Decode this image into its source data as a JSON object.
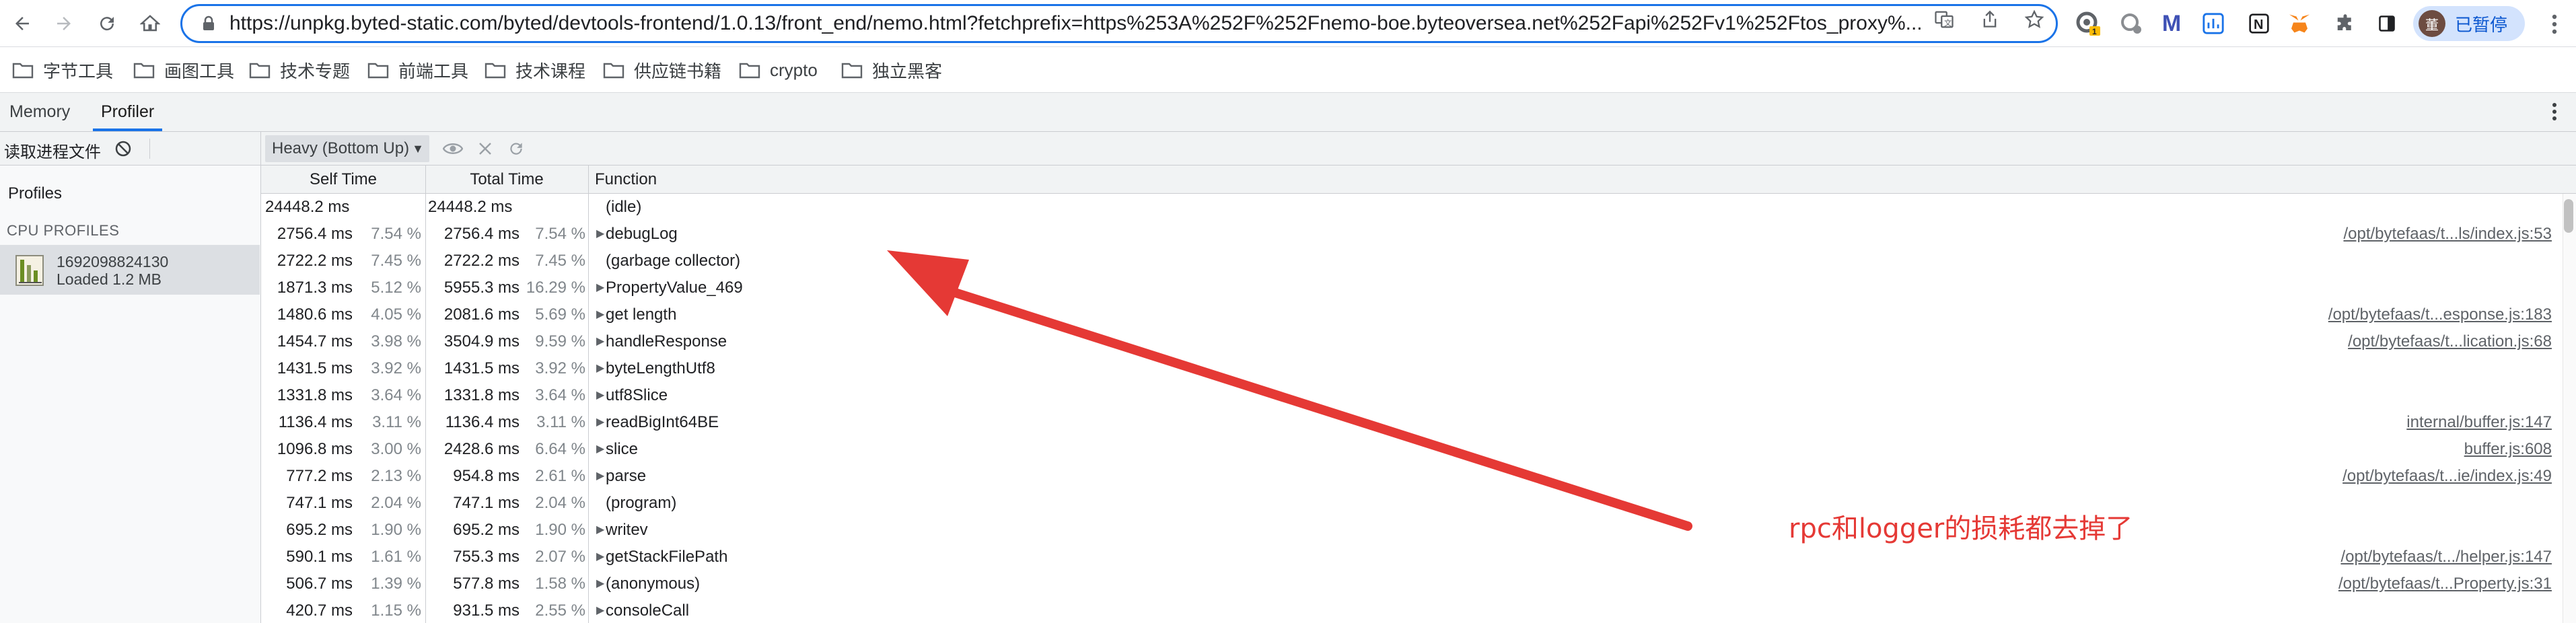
{
  "browser": {
    "url": "https://unpkg.byted-static.com/byted/devtools-frontend/1.0.13/front_end/nemo.html?fetchprefix=https%253A%252F%252Fnemo-boe.byteoversea.net%252Fapi%252Fv1%252Ftos_proxy%...",
    "paused_label": "已暂停",
    "profile_initial": "董"
  },
  "bookmarks": [
    "字节工具",
    "画图工具",
    "技术专题",
    "前端工具",
    "技术课程",
    "供应链书籍",
    "crypto",
    "独立黑客"
  ],
  "devtools": {
    "tabs": [
      "Memory",
      "Profiler"
    ],
    "active_tab": "Profiler"
  },
  "sidebar": {
    "load_label": "读取进程文件",
    "profiles_heading": "Profiles",
    "cpu_heading": "CPU PROFILES",
    "profile": {
      "name": "1692098824130",
      "subtitle": "Loaded 1.2 MB"
    }
  },
  "profiler": {
    "view_mode": "Heavy (Bottom Up)",
    "columns": {
      "self": "Self Time",
      "total": "Total Time",
      "function": "Function"
    },
    "rows": [
      {
        "self": "24448.2 ms",
        "self_pct": "",
        "total": "24448.2 ms",
        "total_pct": "",
        "expand": "",
        "fn": "(idle)",
        "loc": ""
      },
      {
        "self": "2756.4 ms",
        "self_pct": "7.54 %",
        "total": "2756.4 ms",
        "total_pct": "7.54 %",
        "expand": "▶",
        "fn": "debugLog",
        "loc": "/opt/bytefaas/t...ls/index.js:53"
      },
      {
        "self": "2722.2 ms",
        "self_pct": "7.45 %",
        "total": "2722.2 ms",
        "total_pct": "7.45 %",
        "expand": "",
        "fn": "(garbage collector)",
        "loc": ""
      },
      {
        "self": "1871.3 ms",
        "self_pct": "5.12 %",
        "total": "5955.3 ms",
        "total_pct": "16.29 %",
        "expand": "▶",
        "fn": "PropertyValue_469",
        "loc": ""
      },
      {
        "self": "1480.6 ms",
        "self_pct": "4.05 %",
        "total": "2081.6 ms",
        "total_pct": "5.69 %",
        "expand": "▶",
        "fn": "get length",
        "loc": "/opt/bytefaas/t...esponse.js:183"
      },
      {
        "self": "1454.7 ms",
        "self_pct": "3.98 %",
        "total": "3504.9 ms",
        "total_pct": "9.59 %",
        "expand": "▶",
        "fn": "handleResponse",
        "loc": "/opt/bytefaas/t...lication.js:68"
      },
      {
        "self": "1431.5 ms",
        "self_pct": "3.92 %",
        "total": "1431.5 ms",
        "total_pct": "3.92 %",
        "expand": "▶",
        "fn": "byteLengthUtf8",
        "loc": ""
      },
      {
        "self": "1331.8 ms",
        "self_pct": "3.64 %",
        "total": "1331.8 ms",
        "total_pct": "3.64 %",
        "expand": "▶",
        "fn": "utf8Slice",
        "loc": ""
      },
      {
        "self": "1136.4 ms",
        "self_pct": "3.11 %",
        "total": "1136.4 ms",
        "total_pct": "3.11 %",
        "expand": "▶",
        "fn": "readBigInt64BE",
        "loc": "internal/buffer.js:147"
      },
      {
        "self": "1096.8 ms",
        "self_pct": "3.00 %",
        "total": "2428.6 ms",
        "total_pct": "6.64 %",
        "expand": "▶",
        "fn": "slice",
        "loc": "buffer.js:608"
      },
      {
        "self": "777.2 ms",
        "self_pct": "2.13 %",
        "total": "954.8 ms",
        "total_pct": "2.61 %",
        "expand": "▶",
        "fn": "parse",
        "loc": "/opt/bytefaas/t...ie/index.js:49"
      },
      {
        "self": "747.1 ms",
        "self_pct": "2.04 %",
        "total": "747.1 ms",
        "total_pct": "2.04 %",
        "expand": "",
        "fn": "(program)",
        "loc": ""
      },
      {
        "self": "695.2 ms",
        "self_pct": "1.90 %",
        "total": "695.2 ms",
        "total_pct": "1.90 %",
        "expand": "▶",
        "fn": "writev",
        "loc": ""
      },
      {
        "self": "590.1 ms",
        "self_pct": "1.61 %",
        "total": "755.3 ms",
        "total_pct": "2.07 %",
        "expand": "▶",
        "fn": "getStackFilePath",
        "loc": "/opt/bytefaas/t.../helper.js:147"
      },
      {
        "self": "506.7 ms",
        "self_pct": "1.39 %",
        "total": "577.8 ms",
        "total_pct": "1.58 %",
        "expand": "▶",
        "fn": "(anonymous)",
        "loc": "/opt/bytefaas/t...Property.js:31"
      },
      {
        "self": "420.7 ms",
        "self_pct": "1.15 %",
        "total": "931.5 ms",
        "total_pct": "2.55 %",
        "expand": "▶",
        "fn": "consoleCall",
        "loc": ""
      }
    ]
  },
  "annotation": {
    "text": "rpc和logger的损耗都去掉了",
    "color": "#e53935"
  },
  "colors": {
    "accent": "#1a73e8",
    "annotation": "#e53935"
  }
}
